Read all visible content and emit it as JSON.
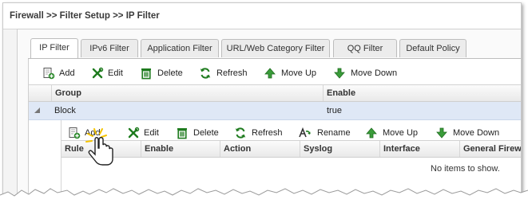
{
  "breadcrumb": "Firewall >> Filter Setup >> IP Filter",
  "tabs": [
    {
      "label": "IP Filter",
      "active": true
    },
    {
      "label": "IPv6 Filter"
    },
    {
      "label": "Application Filter"
    },
    {
      "label": "URL/Web Category Filter"
    },
    {
      "label": "QQ Filter"
    },
    {
      "label": "Default Policy"
    }
  ],
  "toolbar": {
    "add": "Add",
    "edit": "Edit",
    "delete": "Delete",
    "refresh": "Refresh",
    "move_up": "Move Up",
    "move_down": "Move Down"
  },
  "group_table": {
    "columns": [
      "Group",
      "Enable"
    ],
    "rows": [
      {
        "group": "Block",
        "enable": "true"
      }
    ]
  },
  "sub_toolbar": {
    "add": "Add",
    "edit": "Edit",
    "delete": "Delete",
    "refresh": "Refresh",
    "rename": "Rename",
    "move_up": "Move Up",
    "move_down": "Move Down"
  },
  "rule_table": {
    "columns": [
      "Rule",
      "Enable",
      "Action",
      "Syslog",
      "Interface",
      "General Firewall..."
    ],
    "empty_text": "No items to show."
  },
  "colors": {
    "selected_row": "#dfe8f6",
    "add_green": "#2e8b2e",
    "move_green": "#3a9c3a",
    "cursor_glow": "#f5c400"
  }
}
